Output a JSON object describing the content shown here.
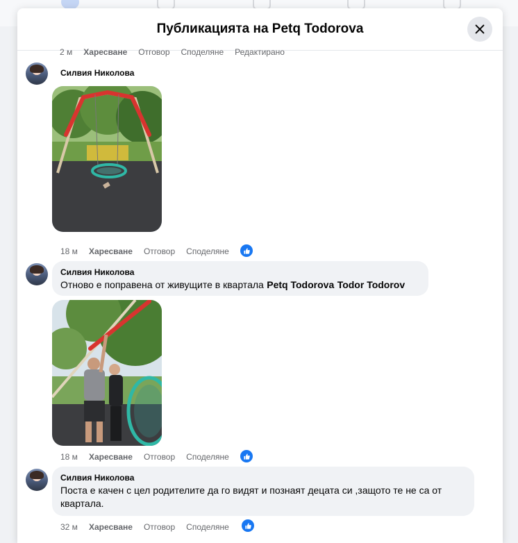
{
  "modal": {
    "title": "Публикацията на Petq Todorova"
  },
  "top_actions": {
    "time": "2 м",
    "like": "Харесване",
    "reply": "Отговор",
    "share": "Споделяне",
    "edited": "Редактирано"
  },
  "comments": [
    {
      "author": "Силвия Николова",
      "time": "18 м",
      "like": "Харесване",
      "reply": "Отговор",
      "share": "Споделяне"
    },
    {
      "author": "Силвия Николова",
      "text": "Отново е поправена от живущите в квартала",
      "tag1": "Petq Todorova",
      "tag2": "Todor Todorov",
      "time": "18 м",
      "like": "Харесване",
      "reply": "Отговор",
      "share": "Споделяне"
    },
    {
      "author": "Силвия Николова",
      "text": "Поста е качен с цел родителите да го видят и познаят децата си ,защото те не са от квартала.",
      "time": "32 м",
      "like": "Харесване",
      "reply": "Отговор",
      "share": "Споделяне"
    }
  ],
  "colors": {
    "accent": "#1877f2",
    "bubble": "#f0f2f5",
    "muted_text": "#65676b"
  },
  "icons": [
    "close-icon",
    "like-icon",
    "avatar",
    "playground-photo"
  ]
}
